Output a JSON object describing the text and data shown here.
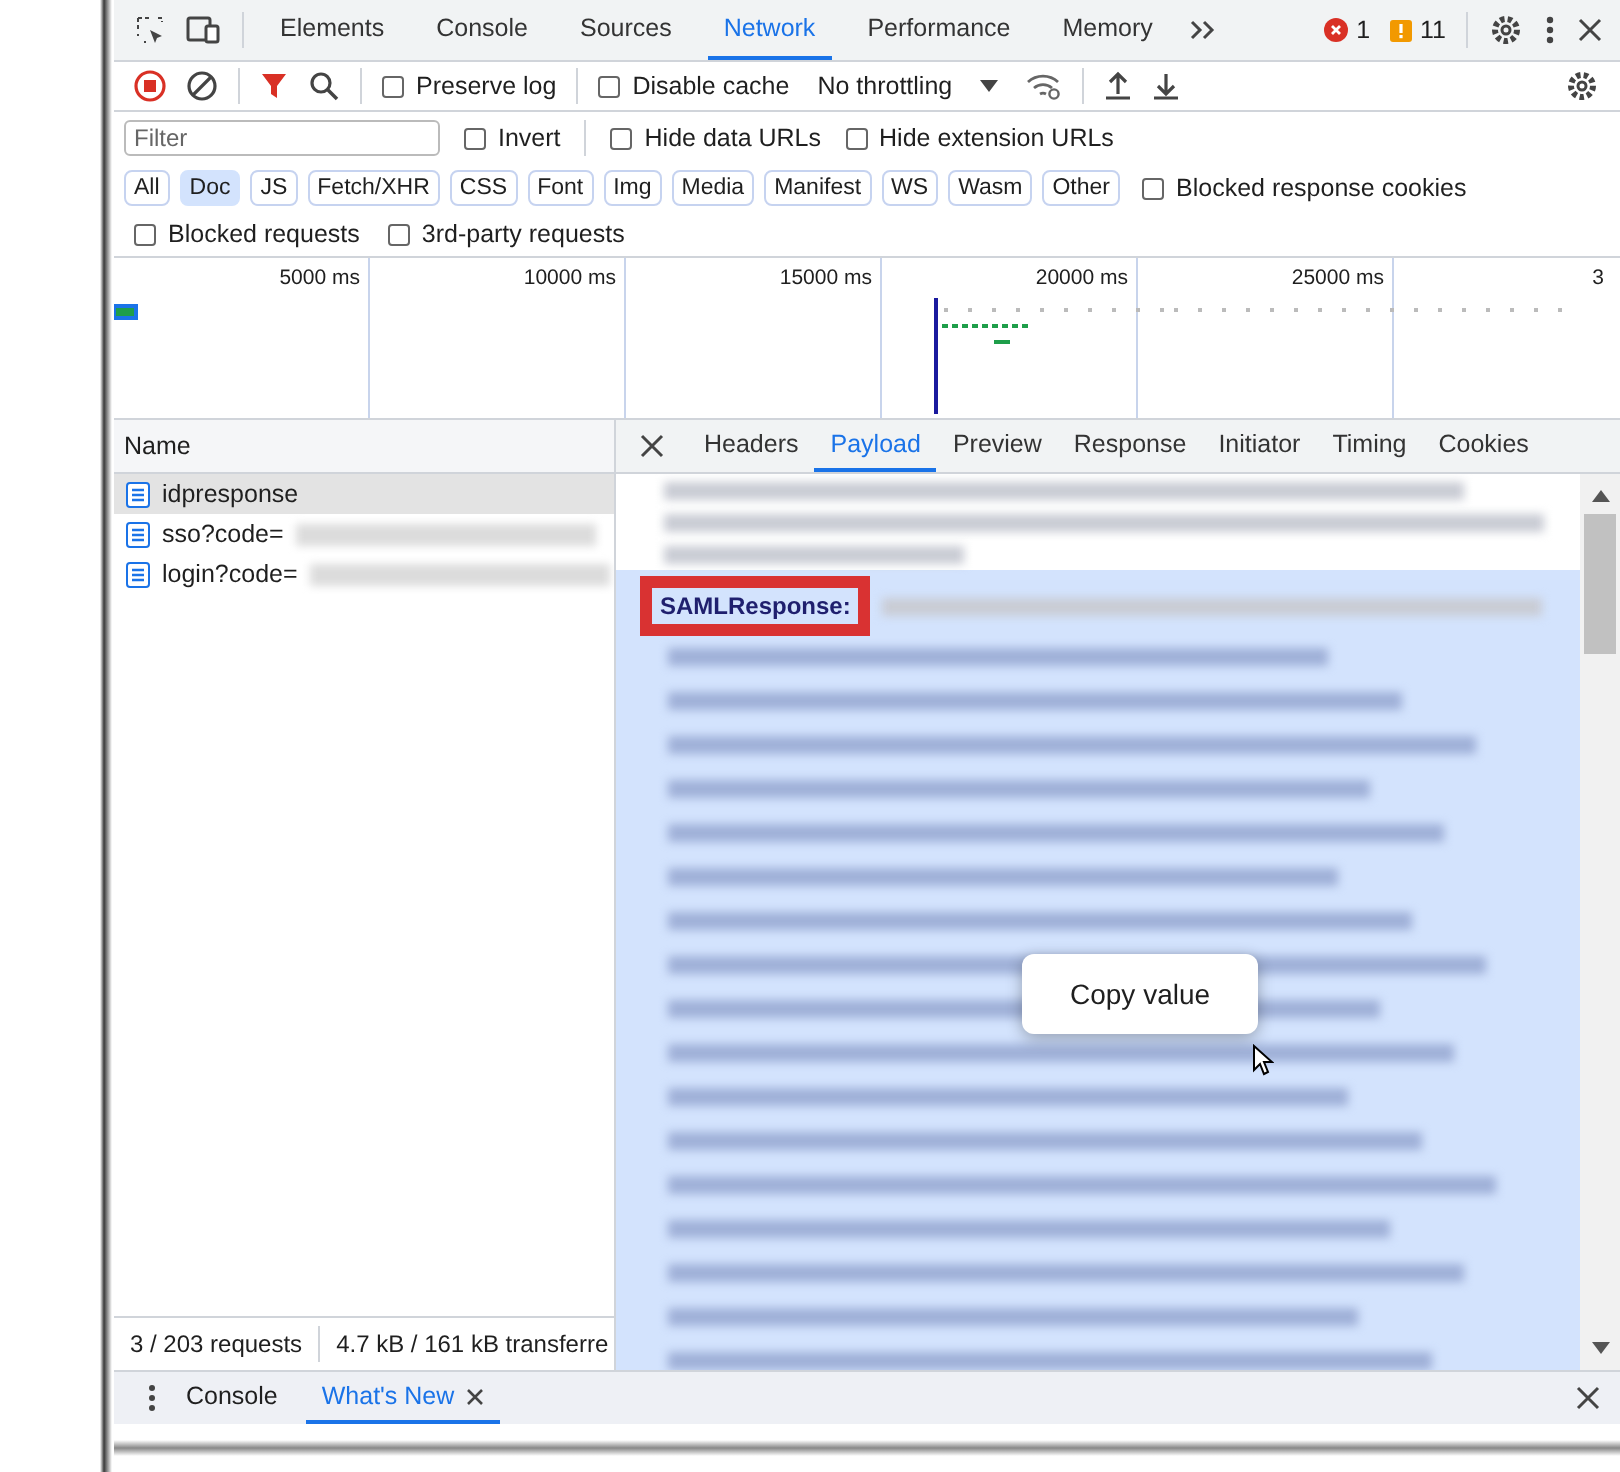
{
  "main_tabs": [
    {
      "label": "Elements",
      "selected": false
    },
    {
      "label": "Console",
      "selected": false
    },
    {
      "label": "Sources",
      "selected": false
    },
    {
      "label": "Network",
      "selected": true
    },
    {
      "label": "Performance",
      "selected": false
    },
    {
      "label": "Memory",
      "selected": false
    }
  ],
  "counters": {
    "errors": "1",
    "warnings": "11"
  },
  "toolbar": {
    "preserve_log": {
      "label": "Preserve log",
      "checked": false
    },
    "disable_cache": {
      "label": "Disable cache",
      "checked": false
    },
    "throttling": "No throttling"
  },
  "filter": {
    "placeholder": "Filter",
    "options": [
      {
        "label": "Invert",
        "checked": false
      },
      {
        "label": "Hide data URLs",
        "checked": false
      },
      {
        "label": "Hide extension URLs",
        "checked": false
      }
    ]
  },
  "type_filters": [
    {
      "label": "All",
      "selected": false
    },
    {
      "label": "Doc",
      "selected": true
    },
    {
      "label": "JS",
      "selected": false
    },
    {
      "label": "Fetch/XHR",
      "selected": false
    },
    {
      "label": "CSS",
      "selected": false
    },
    {
      "label": "Font",
      "selected": false
    },
    {
      "label": "Img",
      "selected": false
    },
    {
      "label": "Media",
      "selected": false
    },
    {
      "label": "Manifest",
      "selected": false
    },
    {
      "label": "WS",
      "selected": false
    },
    {
      "label": "Wasm",
      "selected": false
    },
    {
      "label": "Other",
      "selected": false
    }
  ],
  "blocked_response_cookies": {
    "label": "Blocked response cookies",
    "checked": false
  },
  "extra_filters": [
    {
      "label": "Blocked requests",
      "checked": false
    },
    {
      "label": "3rd-party requests",
      "checked": false
    }
  ],
  "overview": {
    "ticks": [
      "5000 ms",
      "10000 ms",
      "15000 ms",
      "20000 ms",
      "25000 ms",
      "3"
    ]
  },
  "requests": {
    "header": "Name",
    "rows": [
      {
        "name": "idpresponse",
        "selected": true
      },
      {
        "name": "sso?code=",
        "selected": false
      },
      {
        "name": "login?code=",
        "selected": false
      }
    ]
  },
  "detail_tabs": [
    {
      "label": "Headers",
      "selected": false
    },
    {
      "label": "Payload",
      "selected": true
    },
    {
      "label": "Preview",
      "selected": false
    },
    {
      "label": "Response",
      "selected": false
    },
    {
      "label": "Initiator",
      "selected": false
    },
    {
      "label": "Timing",
      "selected": false
    },
    {
      "label": "Cookies",
      "selected": false
    }
  ],
  "payload": {
    "key": "SAMLResponse:"
  },
  "context_menu": {
    "items": [
      "Copy value"
    ]
  },
  "status_bar": {
    "requests": "3 / 203 requests",
    "transferred": "4.7 kB / 161 kB transferre"
  },
  "drawer_tabs": [
    {
      "label": "Console",
      "selected": false,
      "closable": false
    },
    {
      "label": "What's New",
      "selected": true,
      "closable": true
    }
  ]
}
